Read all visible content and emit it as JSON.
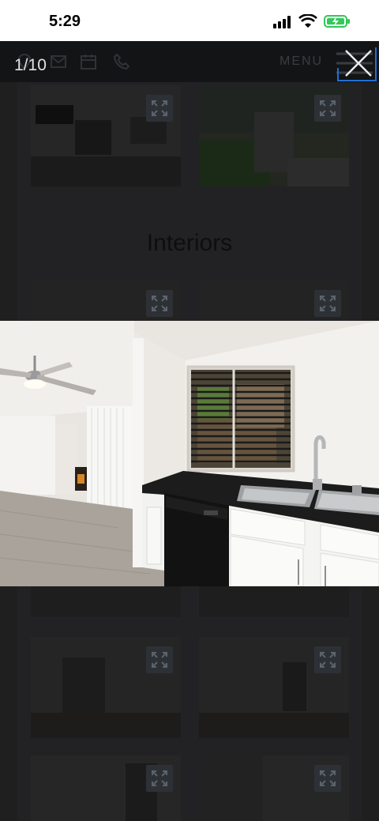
{
  "status": {
    "time": "5:29"
  },
  "header": {
    "counter": "1/10",
    "menu_label": "MENU",
    "icons": [
      "map-pin-icon",
      "mail-icon",
      "calendar-icon",
      "phone-icon"
    ]
  },
  "gallery": {
    "section_title": "Interiors"
  },
  "colors": {
    "navbar": "#121416",
    "overlay": "#1f1f1f",
    "accent_focus": "#1f6fd6",
    "battery_green": "#34c759"
  }
}
